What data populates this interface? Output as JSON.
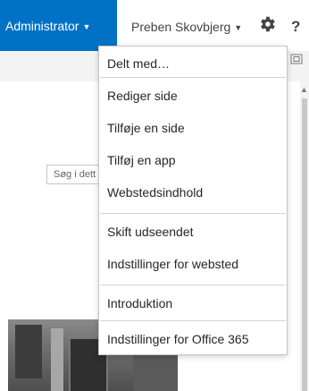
{
  "suite_bar": {
    "admin_label": "Administrator",
    "user_label": "Preben Skovbjerg",
    "caret": "▼",
    "help_label": "?"
  },
  "search": {
    "value": "Søg i dett"
  },
  "settings_menu": {
    "items": [
      {
        "label": "Delt med…"
      },
      {
        "label": "Rediger side"
      },
      {
        "label": "Tilføje en side"
      },
      {
        "label": "Tilføj en app"
      },
      {
        "label": "Webstedsindhold"
      },
      {
        "label": "Skift udseendet"
      },
      {
        "label": "Indstillinger for websted"
      },
      {
        "label": "Introduktion"
      },
      {
        "label": "Indstillinger for Office 365"
      }
    ]
  },
  "colors": {
    "accent": "#0072c6",
    "menu_border": "#c6c6c6",
    "ribbon": "#f3f3f3"
  },
  "icons": [
    "gear-icon",
    "focus-icon",
    "caret-down-icon",
    "scroll-up-icon"
  ]
}
